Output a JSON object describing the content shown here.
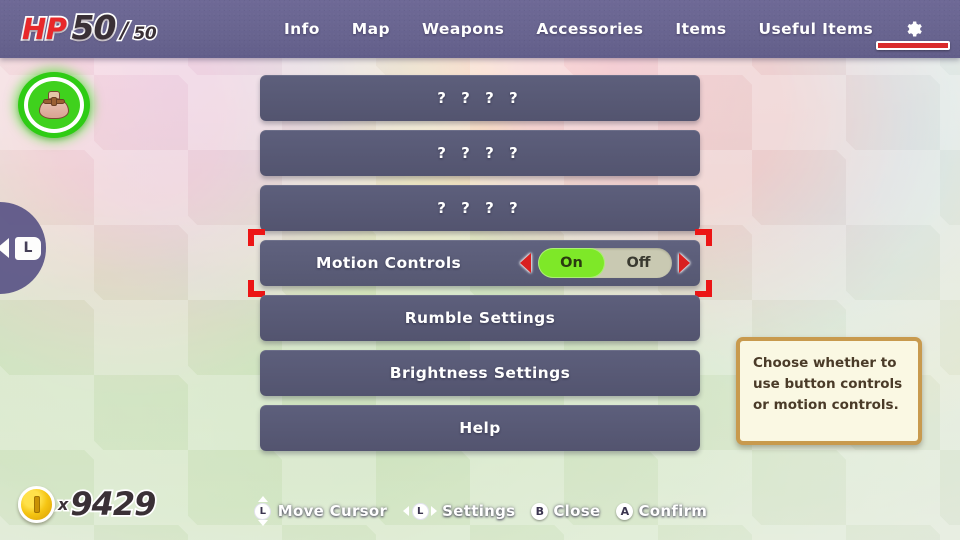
{
  "hud": {
    "hp": {
      "label": "HP",
      "current": "50",
      "separator": "/",
      "max": "50"
    },
    "pouch_icon": "coin-bag-icon",
    "coins": {
      "icon": "coin-icon",
      "multiplier": "x",
      "count": "9429"
    }
  },
  "nav": {
    "items": [
      {
        "label": "Info",
        "name": "tab-info"
      },
      {
        "label": "Map",
        "name": "tab-map"
      },
      {
        "label": "Weapons",
        "name": "tab-weapons"
      },
      {
        "label": "Accessories",
        "name": "tab-accessories"
      },
      {
        "label": "Items",
        "name": "tab-items"
      },
      {
        "label": "Useful Items",
        "name": "tab-useful-items"
      }
    ],
    "settings_icon": "gear-icon",
    "active_tab": "settings",
    "active_underline_color": "#d92b2b"
  },
  "side_nav": {
    "prev_button_key": "L",
    "arrow_icon": "chevron-left-icon"
  },
  "menu": {
    "rows": [
      {
        "label": "? ? ? ?",
        "locked": true
      },
      {
        "label": "? ? ? ?",
        "locked": true
      },
      {
        "label": "? ? ? ?",
        "locked": true
      }
    ],
    "selected_row": {
      "label": "Motion Controls",
      "left_arrow": "arrow-left-icon",
      "right_arrow": "arrow-right-icon",
      "options": [
        {
          "label": "On",
          "active": true
        },
        {
          "label": "Off",
          "active": false
        }
      ],
      "selected_value": "On",
      "highlight_color": "#7ee828",
      "bracket_color": "#ec1515"
    },
    "rows_after": [
      {
        "label": "Rumble Settings"
      },
      {
        "label": "Brightness Settings"
      },
      {
        "label": "Help"
      }
    ]
  },
  "tooltip": {
    "text": "Choose whether to use button controls or motion controls.",
    "border_color": "#c89a4e",
    "background_color": "#faf8e3"
  },
  "hints": [
    {
      "glyph": "L",
      "icon": "stick-updown-icon",
      "label": "Move Cursor"
    },
    {
      "glyph": "L",
      "icon": "stick-leftright-icon",
      "label": "Settings"
    },
    {
      "glyph": "B",
      "icon": "button-b-icon",
      "label": "Close"
    },
    {
      "glyph": "A",
      "icon": "button-a-icon",
      "label": "Confirm"
    }
  ]
}
